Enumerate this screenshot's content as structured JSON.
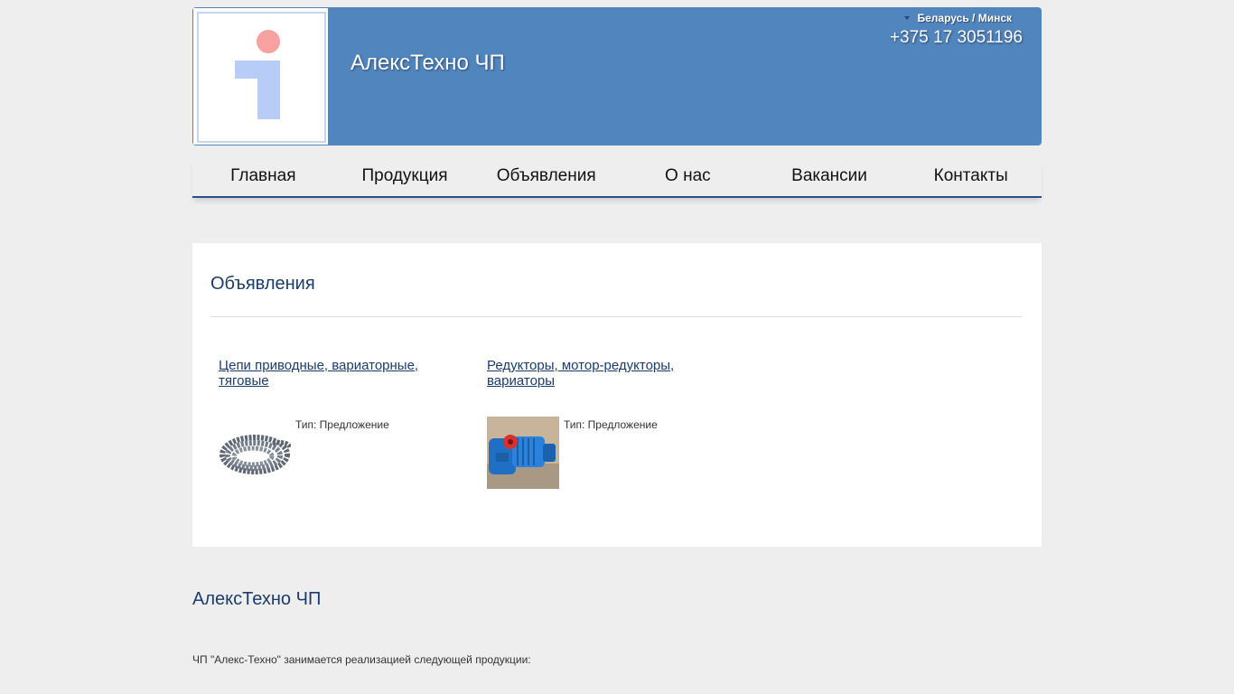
{
  "header": {
    "company_name": "АлексТехно ЧП",
    "region": "Беларусь / Минск",
    "phone": "+375 17 3051196",
    "logo_icon": "info-person-icon"
  },
  "nav": {
    "items": [
      {
        "label": "Главная"
      },
      {
        "label": "Продукция"
      },
      {
        "label": "Объявления"
      },
      {
        "label": "О нас"
      },
      {
        "label": "Вакансии"
      },
      {
        "label": "Контакты"
      }
    ]
  },
  "main": {
    "title": "Объявления",
    "ads": [
      {
        "title": "Цепи приводные, вариаторные, тяговые",
        "type": "Тип: Предложение",
        "thumb_icon": "chain-image"
      },
      {
        "title": "Редукторы, мотор-редукторы, вариаторы",
        "type": "Тип: Предложение",
        "thumb_icon": "gear-motor-image"
      }
    ]
  },
  "footer": {
    "title": "АлексТехно ЧП",
    "text": "ЧП \"Алекс-Техно\" занимается реализацией следующей продукции:"
  },
  "colors": {
    "header_bg": "#5185be",
    "nav_border": "#284f8d",
    "heading": "#1a3d6b",
    "page_bg": "#eeeeee"
  }
}
